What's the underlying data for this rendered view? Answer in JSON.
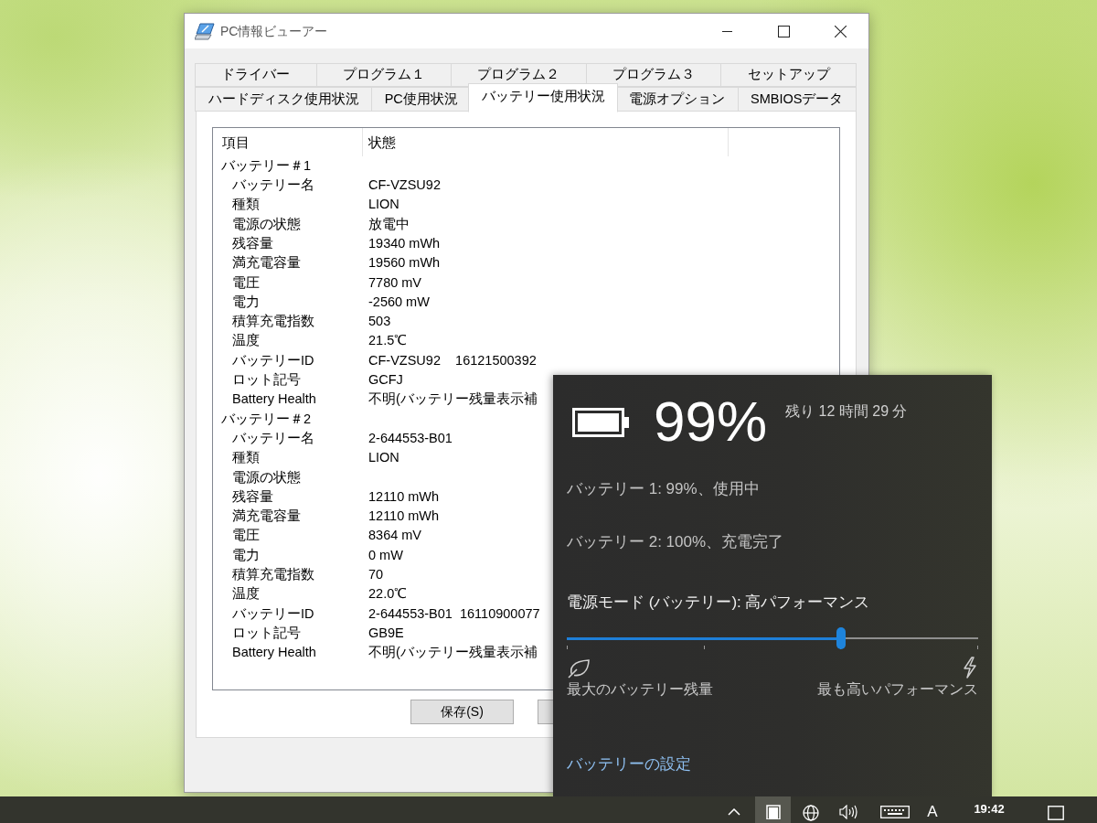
{
  "window": {
    "title": "PC情報ビューアー"
  },
  "tab_rows": [
    [
      {
        "label": "ドライバー",
        "selected": false
      },
      {
        "label": "プログラム１",
        "selected": false
      },
      {
        "label": "プログラム２",
        "selected": false
      },
      {
        "label": "プログラム３",
        "selected": false
      },
      {
        "label": "セットアップ",
        "selected": false
      }
    ],
    [
      {
        "label": "ハードディスク使用状況",
        "selected": false
      },
      {
        "label": "PC使用状況",
        "selected": false
      },
      {
        "label": "バッテリー使用状況",
        "selected": true
      },
      {
        "label": "電源オプション",
        "selected": false
      },
      {
        "label": "SMBIOSデータ",
        "selected": false
      }
    ]
  ],
  "list": {
    "columns": [
      "項目",
      "状態"
    ],
    "groups": [
      {
        "label": "バッテリー＃1",
        "rows": [
          {
            "item": "バッテリー名",
            "state": "CF-VZSU92"
          },
          {
            "item": "種類",
            "state": "LION"
          },
          {
            "item": "電源の状態",
            "state": "放電中"
          },
          {
            "item": "残容量",
            "state": "19340 mWh"
          },
          {
            "item": "満充電容量",
            "state": "19560 mWh"
          },
          {
            "item": "電圧",
            "state": "7780 mV"
          },
          {
            "item": "電力",
            "state": "-2560 mW"
          },
          {
            "item": "積算充電指数",
            "state": "503"
          },
          {
            "item": "温度",
            "state": "21.5℃"
          },
          {
            "item": "バッテリーID",
            "state": "CF-VZSU92    16121500392"
          },
          {
            "item": "ロット記号",
            "state": "GCFJ"
          },
          {
            "item": "Battery Health",
            "state": "不明(バッテリー残量表示補"
          }
        ]
      },
      {
        "label": "バッテリー＃2",
        "rows": [
          {
            "item": "バッテリー名",
            "state": "2-644553-B01"
          },
          {
            "item": "種類",
            "state": "LION"
          },
          {
            "item": "電源の状態"
          },
          {
            "item": "残容量",
            "state": "12110 mWh"
          },
          {
            "item": "満充電容量",
            "state": "12110 mWh"
          },
          {
            "item": "電圧",
            "state": "8364 mV"
          },
          {
            "item": "電力",
            "state": "0 mW"
          },
          {
            "item": "積算充電指数",
            "state": "70"
          },
          {
            "item": "温度",
            "state": "22.0℃"
          },
          {
            "item": "バッテリーID",
            "state": "2-644553-B01  16110900077"
          },
          {
            "item": "ロット記号",
            "state": "GB9E"
          },
          {
            "item": "Battery Health",
            "state": "不明(バッテリー残量表示補"
          }
        ]
      }
    ]
  },
  "buttons": [
    {
      "kind": "labeled",
      "label": "保存(S)"
    },
    {
      "kind": "covered"
    }
  ],
  "battery_flyout": {
    "percent": "99%",
    "remaining": "残り 12 時間 29 分",
    "batteries": [
      "バッテリー 1: 99%、使用中",
      "バッテリー 2: 100%、充電完了"
    ],
    "power_mode": {
      "label": "電源モード (バッテリー): 高パフォーマンス",
      "level": 0.667,
      "min_label": "最大のバッテリー残量",
      "max_label": "最も高いパフォーマンス"
    },
    "settings_link": "バッテリーの設定"
  },
  "taskbar": {
    "battery_selected": true,
    "ime_mode": "A",
    "clock": "19:42"
  }
}
